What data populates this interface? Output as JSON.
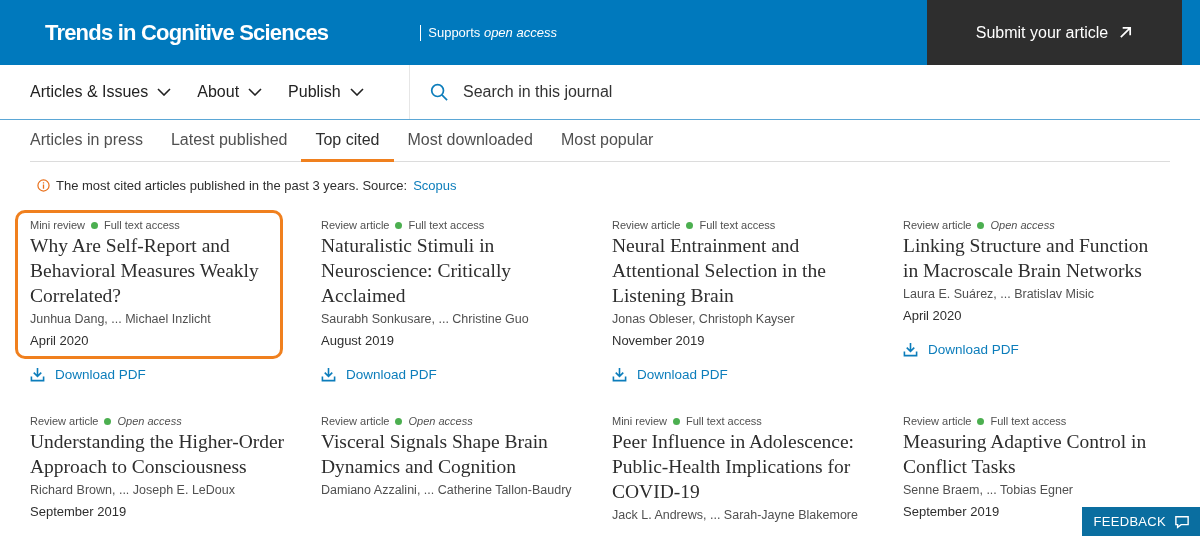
{
  "header": {
    "journal_title": "Trends in Cognitive Sciences",
    "tagline": "Supports *open access*",
    "submit_button": "Submit your article"
  },
  "nav": {
    "menus": [
      {
        "label": "Articles & Issues"
      },
      {
        "label": "About"
      },
      {
        "label": "Publish"
      }
    ],
    "search": {
      "placeholder": "Search in this journal"
    }
  },
  "tabs": [
    {
      "label": "Articles in press",
      "selected": false
    },
    {
      "label": "Latest published",
      "selected": false
    },
    {
      "label": "Top cited",
      "selected": true
    },
    {
      "label": "Most downloaded",
      "selected": false
    },
    {
      "label": "Most popular",
      "selected": false
    }
  ],
  "notice": {
    "text": "The most cited articles published in the past 3 years. Source:",
    "link": "Scopus"
  },
  "articles": [
    {
      "type": "Mini review",
      "access": "Full text access",
      "kind": "full",
      "title": "Why Are Self-Report and Behavioral Measures Weakly Correlated?",
      "authors": "Junhua Dang, ... Michael Inzlicht",
      "date": "April 2020",
      "download": "Download PDF",
      "highlighted": true
    },
    {
      "type": "Review article",
      "access": "Full text access",
      "kind": "full",
      "title": "Naturalistic Stimuli in Neuroscience: Critically Acclaimed",
      "authors": "Saurabh Sonkusare, ... Christine Guo",
      "date": "August 2019",
      "download": "Download PDF",
      "highlighted": false
    },
    {
      "type": "Review article",
      "access": "Full text access",
      "kind": "full",
      "title": "Neural Entrainment and Attentional Selection in the Listening Brain",
      "authors": "Jonas Obleser, Christoph Kayser",
      "date": "November 2019",
      "download": "Download PDF",
      "highlighted": false
    },
    {
      "type": "Review article",
      "access": "Open access",
      "kind": "open",
      "title": "Linking Structure and Function in Macroscale Brain Networks",
      "authors": "Laura E. Suárez, ... Bratislav Misic",
      "date": "April 2020",
      "download": "Download PDF",
      "highlighted": false
    },
    {
      "type": "Review article",
      "access": "Open access",
      "kind": "open",
      "title": "Understanding the Higher-Order Approach to Consciousness",
      "authors": "Richard Brown, ... Joseph E. LeDoux",
      "date": "September 2019",
      "highlighted": false
    },
    {
      "type": "Review article",
      "access": "Open access",
      "kind": "open",
      "title": "Visceral Signals Shape Brain Dynamics and Cognition",
      "authors": "Damiano Azzalini, ... Catherine Tallon-Baudry",
      "highlighted": false
    },
    {
      "type": "Mini review",
      "access": "Full text access",
      "kind": "full",
      "title": "Peer Influence in Adolescence: Public-Health Implications for COVID-19",
      "authors": "Jack L. Andrews, ... Sarah-Jayne Blakemore",
      "highlighted": false
    },
    {
      "type": "Review article",
      "access": "Full text access",
      "kind": "full",
      "title": "Measuring Adaptive Control in Conflict Tasks",
      "authors": "Senne Braem, ... Tobias Egner",
      "date": "September 2019",
      "highlighted": false
    }
  ],
  "feedback_button": "FEEDBACK"
}
